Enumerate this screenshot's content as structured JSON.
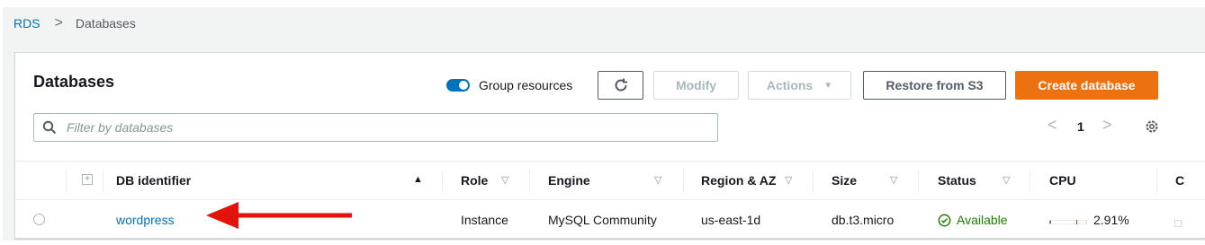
{
  "breadcrumb": {
    "root": "RDS",
    "separator": ">",
    "current": "Databases"
  },
  "panel": {
    "title": "Databases",
    "group_resources_label": "Group resources",
    "group_resources_on": true,
    "buttons": {
      "modify": "Modify",
      "actions": "Actions",
      "restore": "Restore from S3",
      "create": "Create database"
    },
    "search": {
      "placeholder": "Filter by databases"
    },
    "pagination": {
      "prev": "<",
      "page": "1",
      "next": ">"
    }
  },
  "table": {
    "columns": [
      "DB identifier",
      "Role",
      "Engine",
      "Region & AZ",
      "Size",
      "Status",
      "CPU",
      "C"
    ],
    "rows": [
      {
        "db_identifier": "wordpress",
        "role": "Instance",
        "engine": "MySQL Community",
        "region_az": "us-east-1d",
        "size": "db.t3.micro",
        "status": "Available",
        "cpu": "2.91%"
      }
    ]
  },
  "colors": {
    "link": "#0073bb",
    "primary": "#ec7211",
    "available": "#1d8102",
    "annotation_arrow": "#e3120b"
  },
  "icons": [
    "refresh-icon",
    "search-icon",
    "settings-icon",
    "check-circle-icon",
    "sort-icon",
    "expand-icon"
  ]
}
